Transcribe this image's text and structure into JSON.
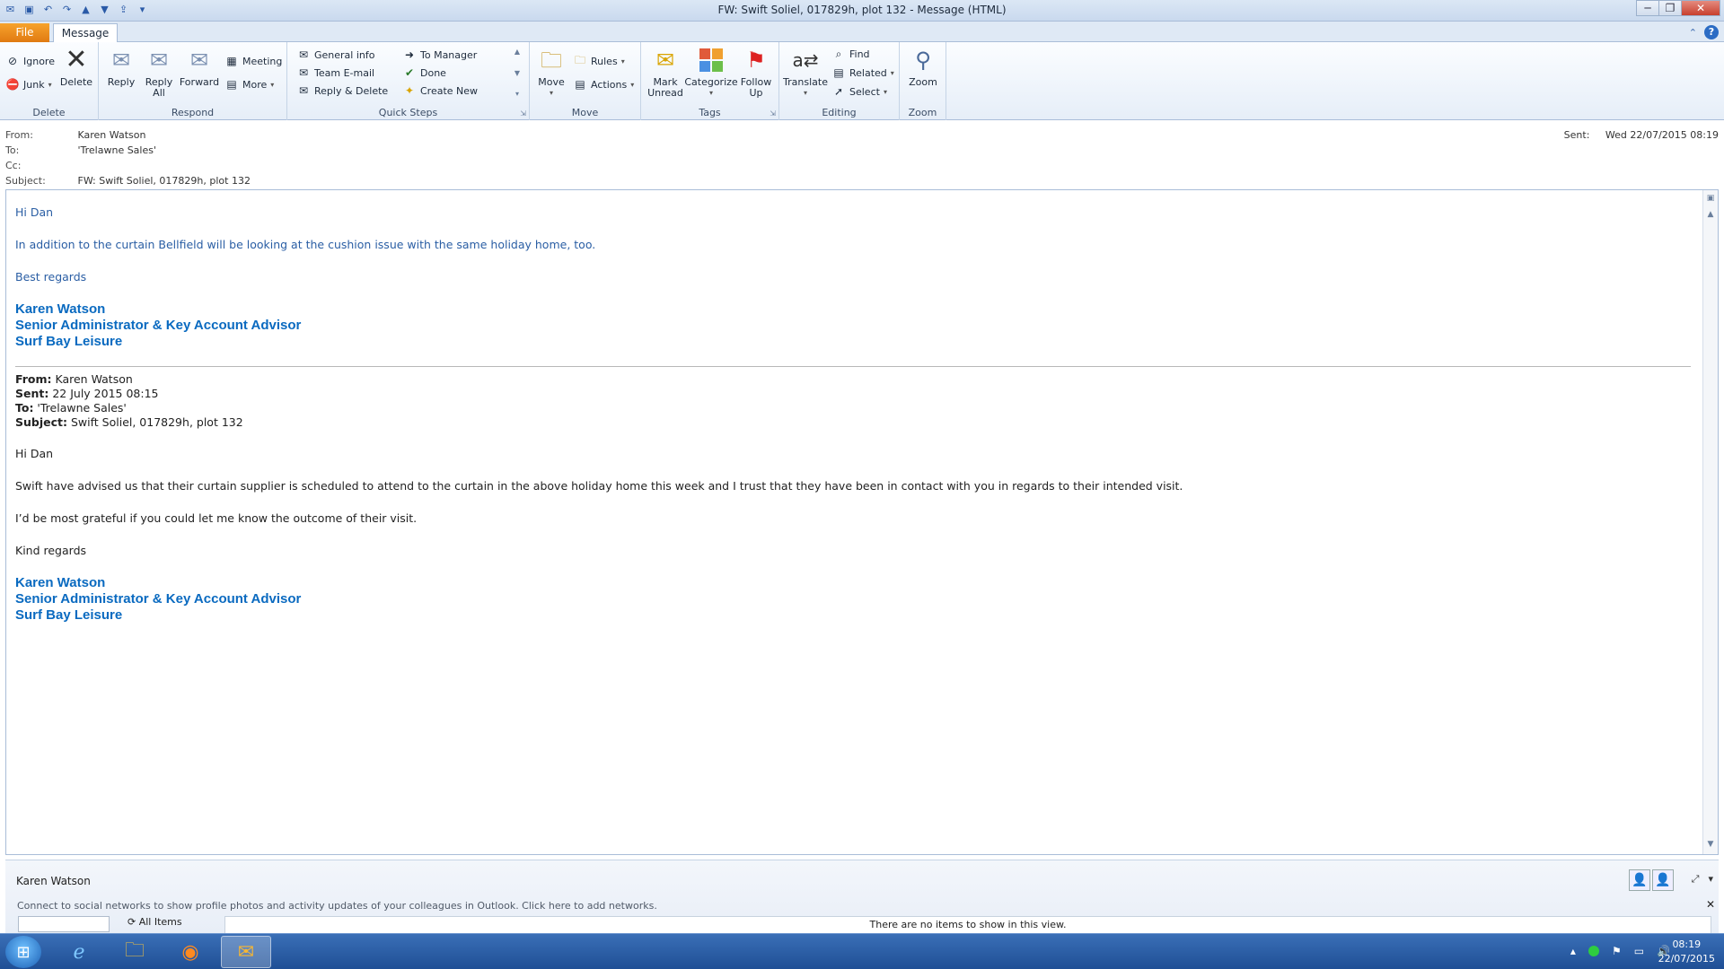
{
  "window": {
    "title": "FW: Swift Soliel, 017829h, plot 132  -  Message (HTML)"
  },
  "tabs": {
    "file": "File",
    "message": "Message"
  },
  "ribbon": {
    "delete_group": {
      "label": "Delete",
      "ignore": "Ignore",
      "junk": "Junk",
      "delete": "Delete"
    },
    "respond_group": {
      "label": "Respond",
      "reply": "Reply",
      "reply_all_line1": "Reply",
      "reply_all_line2": "All",
      "forward": "Forward",
      "meeting": "Meeting",
      "more": "More"
    },
    "quicksteps_group": {
      "label": "Quick Steps",
      "items": [
        "General info",
        "Team E-mail",
        "Reply & Delete",
        "To Manager",
        "Done",
        "Create New"
      ]
    },
    "move_group": {
      "label": "Move",
      "move": "Move",
      "rules": "Rules",
      "actions": "Actions"
    },
    "tags_group": {
      "label": "Tags",
      "mark_unread_line1": "Mark",
      "mark_unread_line2": "Unread",
      "categorize": "Categorize",
      "follow_up_line1": "Follow",
      "follow_up_line2": "Up"
    },
    "editing_group": {
      "label": "Editing",
      "translate": "Translate",
      "find": "Find",
      "related": "Related",
      "select": "Select"
    },
    "zoom_group": {
      "label": "Zoom",
      "zoom": "Zoom"
    }
  },
  "header": {
    "from_label": "From:",
    "from_value": "Karen Watson",
    "to_label": "To:",
    "to_value": "'Trelawne Sales'",
    "cc_label": "Cc:",
    "cc_value": "",
    "subject_label": "Subject:",
    "subject_value": "FW: Swift Soliel, 017829h, plot 132",
    "sent_label": "Sent:",
    "sent_value": "Wed 22/07/2015 08:19"
  },
  "body": {
    "greeting": "Hi Dan",
    "para1": "In addition to the curtain Bellfield will be looking at the cushion issue with the same holiday home, too.",
    "closing": "Best regards",
    "sig_name": "Karen Watson",
    "sig_title": "Senior Administrator & Key Account Advisor",
    "sig_company": "Surf Bay Leisure",
    "fwd": {
      "from_label": "From:",
      "from_value": " Karen Watson",
      "sent_label": "Sent:",
      "sent_value": " 22 July 2015 08:15",
      "to_label": "To:",
      "to_value": " 'Trelawne Sales'",
      "subject_label": "Subject:",
      "subject_value": " Swift Soliel, 017829h, plot 132"
    },
    "fwd_greeting": "Hi Dan",
    "fwd_para1": "Swift have advised us that their curtain supplier is scheduled to attend to the curtain in the above holiday home this week and I trust that they have been in contact with you in regards to their intended visit.",
    "fwd_para2": "I’d be most grateful if you could let me know the outcome of their visit.",
    "fwd_closing": "Kind regards",
    "fwd_sig_name": "Karen Watson",
    "fwd_sig_title": "Senior Administrator & Key Account Advisor",
    "fwd_sig_company": "Surf Bay Leisure"
  },
  "people_pane": {
    "name": "Karen Watson",
    "social_text": "Connect to social networks to show profile photos and activity updates of your colleagues in Outlook. Click here to add networks.",
    "all_items": "All Items",
    "no_items": "There are no items to show in this view."
  },
  "taskbar": {
    "time": "08:19",
    "date": "22/07/2015"
  }
}
